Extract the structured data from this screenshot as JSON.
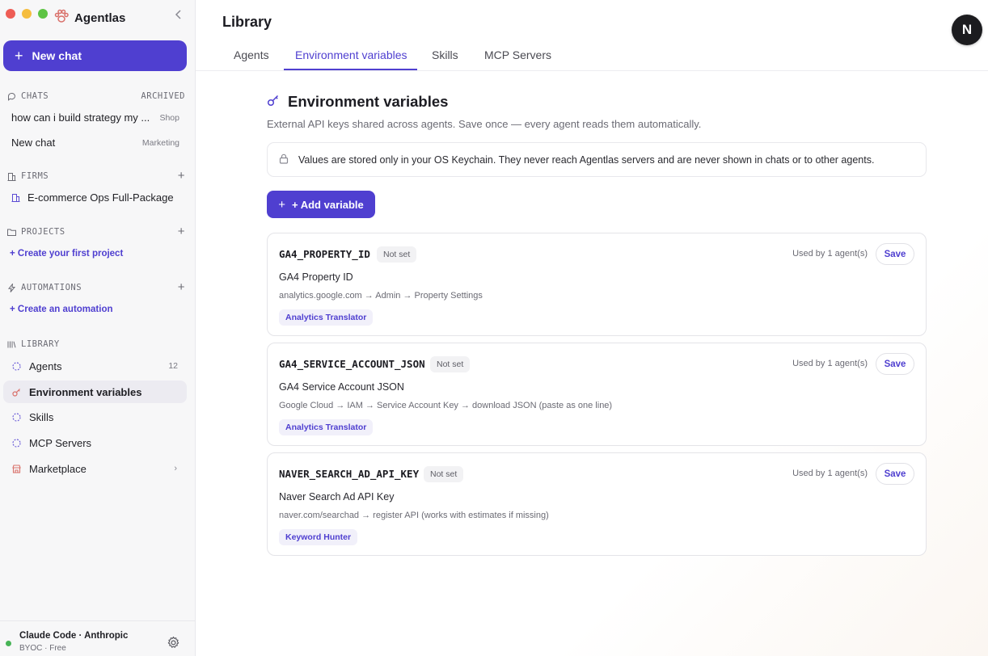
{
  "app": {
    "name": "Agentlas",
    "accent_color": "#4f3fd0"
  },
  "sidebar": {
    "new_chat_label": "New chat",
    "chats": {
      "title": "CHATS",
      "archived_label": "ARCHIVED",
      "items": [
        {
          "label": "how can i build strategy my ...",
          "tag": "Shop"
        },
        {
          "label": "New chat",
          "tag": "Marketing"
        }
      ]
    },
    "firms": {
      "title": "FIRMS",
      "items": [
        {
          "label": "E-commerce Ops Full-Package"
        }
      ]
    },
    "projects": {
      "title": "PROJECTS",
      "create_label": "+ Create your first project"
    },
    "automations": {
      "title": "AUTOMATIONS",
      "create_label": "+ Create an automation"
    },
    "library": {
      "title": "LIBRARY",
      "items": [
        {
          "label": "Agents",
          "count": "12",
          "icon": "dotted-circle-icon"
        },
        {
          "label": "Environment variables",
          "icon": "key-icon",
          "active": true
        },
        {
          "label": "Skills",
          "icon": "dotted-circle-icon"
        },
        {
          "label": "MCP Servers",
          "icon": "dotted-circle-icon"
        },
        {
          "label": "Marketplace",
          "icon": "store-icon"
        }
      ]
    },
    "footer": {
      "provider": "Claude Code · Anthropic",
      "plan": "BYOC · Free",
      "status_color": "#47b456"
    }
  },
  "header": {
    "title": "Library",
    "avatar_initial": "N",
    "tabs": [
      {
        "label": "Agents"
      },
      {
        "label": "Environment variables",
        "active": true
      },
      {
        "label": "Skills"
      },
      {
        "label": "MCP Servers"
      }
    ]
  },
  "main": {
    "title": "Environment variables",
    "subtitle": "External API keys shared across agents. Save once — every agent reads them automatically.",
    "notice": "Values are stored only in your OS Keychain. They never reach Agentlas servers and are never shown in chats or to other agents.",
    "add_variable_label": "+ Add variable",
    "variables": [
      {
        "key": "GA4_PROPERTY_ID",
        "status": "Not set",
        "used_by": "Used by 1 agent(s)",
        "save_label": "Save",
        "label": "GA4 Property ID",
        "hint": "analytics.google.com → Admin → Property Settings",
        "agent": "Analytics Translator"
      },
      {
        "key": "GA4_SERVICE_ACCOUNT_JSON",
        "status": "Not set",
        "used_by": "Used by 1 agent(s)",
        "save_label": "Save",
        "label": "GA4 Service Account JSON",
        "hint": "Google Cloud → IAM → Service Account Key → download JSON (paste as one line)",
        "agent": "Analytics Translator"
      },
      {
        "key": "NAVER_SEARCH_AD_API_KEY",
        "status": "Not set",
        "used_by": "Used by 1 agent(s)",
        "save_label": "Save",
        "label": "Naver Search Ad API Key",
        "hint": "naver.com/searchad → register API (works with estimates if missing)",
        "agent": "Keyword Hunter"
      }
    ]
  }
}
